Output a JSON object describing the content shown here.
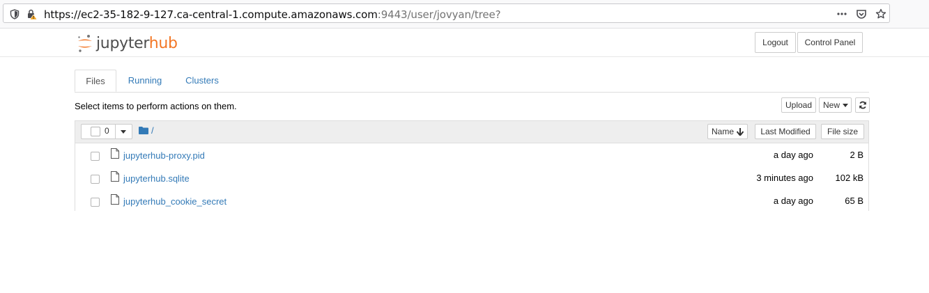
{
  "browser": {
    "url_host": "https://ec2-35-182-9-127.ca-central-1.compute.amazonaws.com",
    "url_rest": ":9443/user/jovyan/tree?",
    "icons": [
      "shield-icon",
      "lock-warning-icon",
      "more-icon",
      "pocket-icon",
      "star-icon"
    ]
  },
  "header": {
    "logo_part1": "jupyter",
    "logo_part2": "hub",
    "logout_label": "Logout",
    "control_panel_label": "Control Panel"
  },
  "tabs": [
    {
      "label": "Files"
    },
    {
      "label": "Running"
    },
    {
      "label": "Clusters"
    }
  ],
  "toolbar": {
    "hint": "Select items to perform actions on them.",
    "upload_label": "Upload",
    "new_label": "New",
    "refresh_icon": "refresh-icon"
  },
  "list_header": {
    "selected_count": "0",
    "breadcrumb": "/",
    "sort_name": "Name",
    "sort_modified": "Last Modified",
    "sort_size": "File size"
  },
  "files": [
    {
      "name": "jupyterhub-proxy.pid",
      "modified": "a day ago",
      "size": "2 B"
    },
    {
      "name": "jupyterhub.sqlite",
      "modified": "3 minutes ago",
      "size": "102 kB"
    },
    {
      "name": "jupyterhub_cookie_secret",
      "modified": "a day ago",
      "size": "65 B"
    }
  ],
  "colors": {
    "link": "#337ab7",
    "accent_orange": "#f37726",
    "header_bg": "#eeeeee"
  }
}
